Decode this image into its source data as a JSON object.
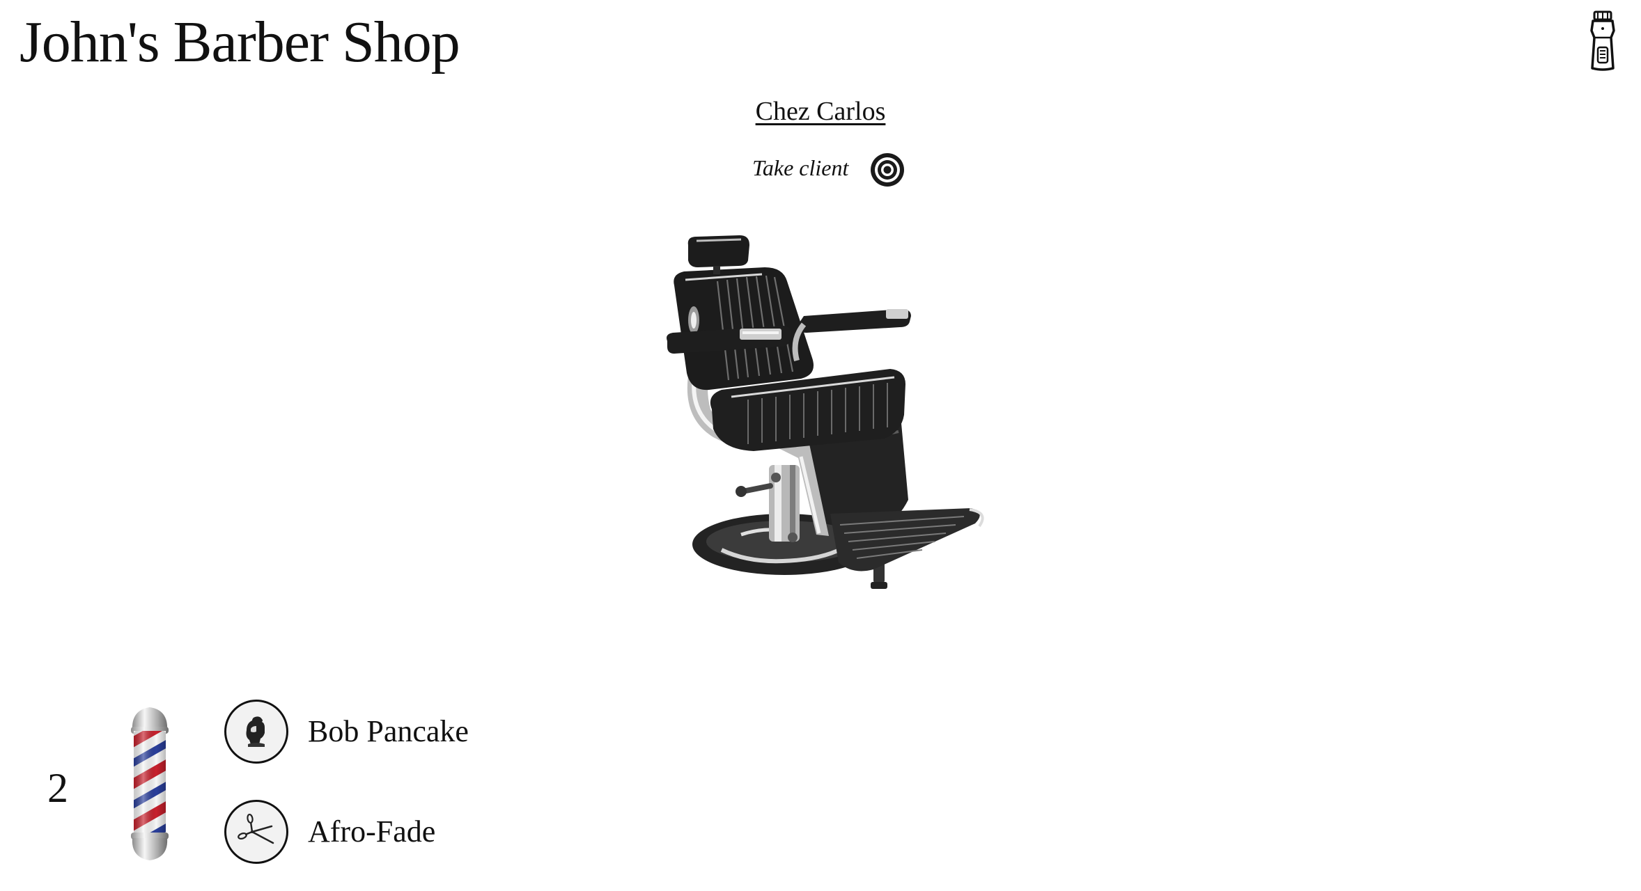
{
  "header": {
    "title": "John's Barber Shop",
    "clipper_icon": "hair-clipper-icon"
  },
  "barber": {
    "name": "Chez Carlos",
    "take_client_label": "Take client",
    "take_client_icon": "target-icon"
  },
  "illustration": {
    "icon": "barber-chair-illustration"
  },
  "queue": {
    "count": "2",
    "pole_icon": "barber-pole-icon",
    "next_client": {
      "name": "Bob Pancake",
      "icon": "client-avatar-icon"
    },
    "next_service": {
      "name": "Afro-Fade",
      "icon": "scissors-icon"
    }
  },
  "colors": {
    "text": "#111111",
    "background": "#ffffff",
    "pole_red": "#c8202c",
    "pole_blue": "#2a3f9c",
    "chrome": "#c9c9c9"
  }
}
